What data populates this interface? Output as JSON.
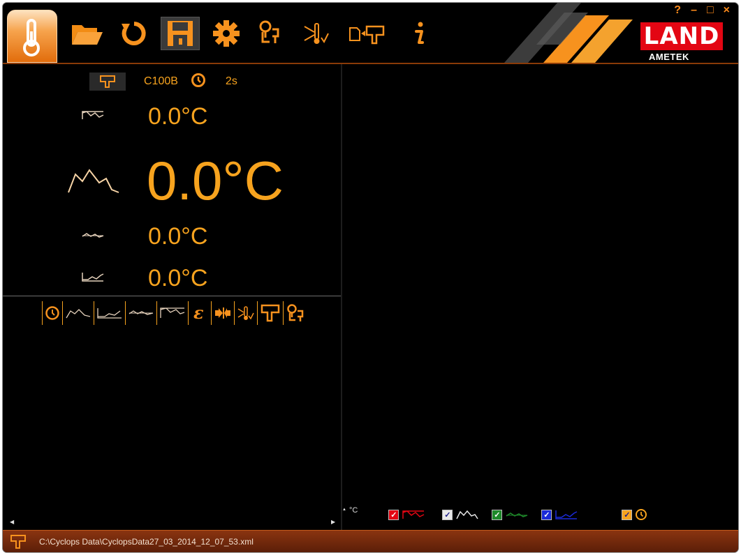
{
  "toolbar": {
    "buttons": [
      {
        "name": "thermometer-app-icon"
      },
      {
        "name": "open-folder-icon"
      },
      {
        "name": "refresh-icon"
      },
      {
        "name": "save-icon"
      },
      {
        "name": "settings-gear-icon"
      },
      {
        "name": "probe-config-icon"
      },
      {
        "name": "temperature-alarm-icon"
      },
      {
        "name": "instrument-connect-icon"
      },
      {
        "name": "info-icon"
      }
    ]
  },
  "window_controls": {
    "help": "?",
    "minimize": "–",
    "maximize": "□",
    "close": "×"
  },
  "logo": {
    "brand": "LAND",
    "company": "AMETEK"
  },
  "instrument": {
    "model": "C100B",
    "interval": "2s"
  },
  "readings": {
    "peak": "0.0°C",
    "live": "0.0°C",
    "average": "0.0°C",
    "valley": "0.0°C"
  },
  "legend": {
    "unit": "°C"
  },
  "status": {
    "file_path": "C:\\Cyclops Data\\CyclopsData27_03_2014_12_07_53.xml"
  },
  "colors": {
    "accent": "#f7a31e",
    "red": "#e30613",
    "status_bar": "#7a2c0c",
    "background": "#000000"
  }
}
